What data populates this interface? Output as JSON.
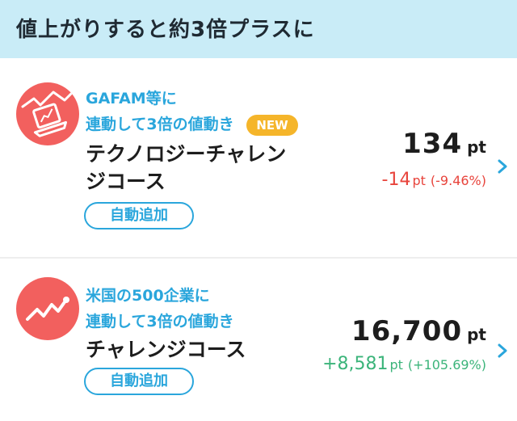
{
  "header": {
    "title": "値上がりすると約3倍プラスに"
  },
  "courses": [
    {
      "icon": "laptop-chart-icon",
      "subtitle_line1": "GAFAM等に",
      "subtitle_line2": "連動して3倍の値動き",
      "badge": "NEW",
      "name_line1": "テクノロジーチャレン",
      "name_line2": "ジコース",
      "points": "134",
      "points_unit": "pt",
      "change_value": "-14",
      "change_unit": "pt",
      "change_percent": "(-9.46%)",
      "auto_add_label": "自動追加"
    },
    {
      "icon": "trending-up-icon",
      "subtitle_line1": "米国の500企業に",
      "subtitle_line2": "連動して3倍の値動き",
      "name_line1": "チャレンジコース",
      "points": "16,700",
      "points_unit": "pt",
      "change_value": "+8,581",
      "change_unit": "pt",
      "change_percent": "(+105.69%)",
      "auto_add_label": "自動追加"
    }
  ],
  "colors": {
    "header_bg": "#c9ecf7",
    "accent_blue": "#2aa6dc",
    "icon_red": "#f2605e",
    "badge_orange": "#f5b52a",
    "negative_red": "#e8443c",
    "positive_green": "#3bb47a"
  }
}
